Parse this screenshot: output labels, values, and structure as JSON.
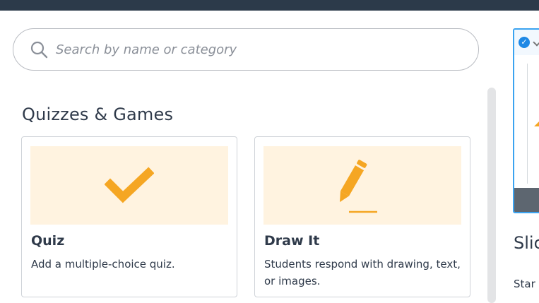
{
  "search": {
    "placeholder": "Search by name or category",
    "icon": "search-icon"
  },
  "section": {
    "title": "Quizzes & Games"
  },
  "cards": [
    {
      "title": "Quiz",
      "description": "Add a multiple-choice quiz.",
      "icon": "checkmark-icon"
    },
    {
      "title": "Draw It",
      "description": "Students respond with drawing, text, or images.",
      "icon": "pencil-icon"
    }
  ],
  "slides_card": {
    "title": "Slic",
    "description": "Star",
    "icon": "check-badge-icon"
  },
  "colors": {
    "topbar": "#2c3a4a",
    "accent_orange": "#f5a623",
    "thumb_bg": "#fff3e0",
    "preview_border": "#3ba3f0"
  }
}
